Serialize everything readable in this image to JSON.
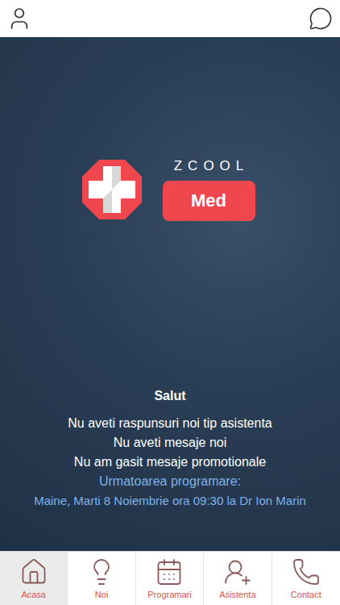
{
  "logo": {
    "brand": "ZCOOL",
    "badge": "Med"
  },
  "greeting": "Salut",
  "notices": [
    "Nu aveti raspunsuri noi tip asistenta",
    "Nu aveti mesaje noi",
    "Nu am gasit mesaje promotionale"
  ],
  "next_appointment": {
    "label": "Urmatoarea programare:",
    "text": "Maine, Marti 8 Noiembrie ora 09:30 la Dr Ion Marin"
  },
  "tabs": [
    {
      "label": "Acasa",
      "selected": true
    },
    {
      "label": "Noi",
      "selected": false
    },
    {
      "label": "Programari",
      "selected": false
    },
    {
      "label": "Asistenta",
      "selected": false
    },
    {
      "label": "Contact",
      "selected": false
    }
  ]
}
